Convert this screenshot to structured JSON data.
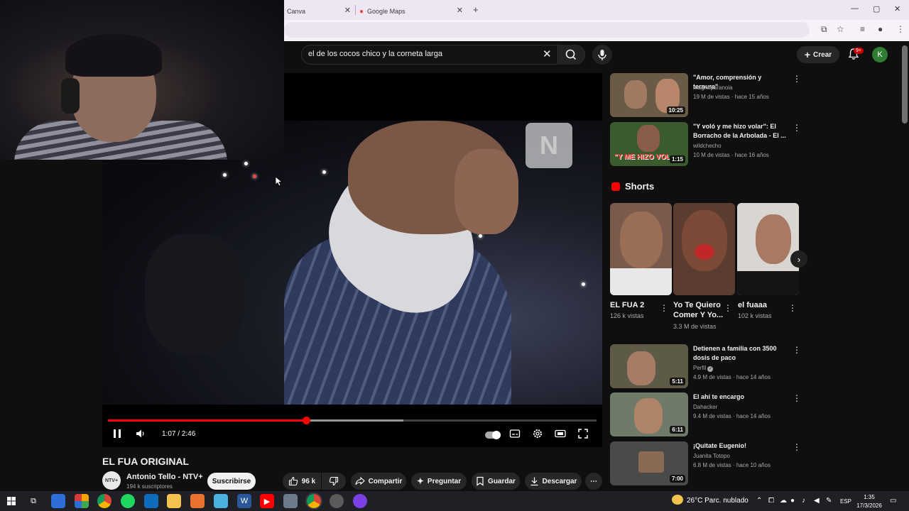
{
  "browser": {
    "tabs": [
      {
        "label": "Canva"
      },
      {
        "label": "Google Maps"
      }
    ],
    "new_tab": "+",
    "controls": {
      "minimize": "—",
      "maximize": "▢",
      "close": "✕"
    }
  },
  "youtube": {
    "search_query": "el de los cocos chico y la corneta larga",
    "create_label": "Crear",
    "notifications_badge": "9+",
    "avatar_letter": "K"
  },
  "player": {
    "time": "1:07 / 2:46",
    "progress_played": 0.405,
    "progress_buffered": 0.605,
    "watermark": "N"
  },
  "video": {
    "title": "EL FUA ORIGINAL",
    "channel_avatar_text": "NTV+",
    "channel": "Antonio Tello - NTV+",
    "subscribers": "194 k suscriptores",
    "subscribe_label": "Suscribirse",
    "likes": "96 k",
    "share_label": "Compartir",
    "ask_label": "Preguntar",
    "save_label": "Guardar",
    "download_label": "Descargar"
  },
  "sidebar": {
    "top_videos": [
      {
        "title": "\"Amor, comprensión y ternura\"",
        "channel": "magnoparanoia",
        "meta": "19 M de vistas · hace 15 años",
        "duration": "10:25",
        "thumb_bg": "#6a5a48"
      },
      {
        "title": "\"Y voló y me hizo volar\": El Borracho de la Arbolada - El ...",
        "channel": "wildchecho",
        "meta": "10 M de vistas · hace 16 años",
        "duration": "1:15",
        "thumb_bg": "#3b5a2e",
        "overlay": "\"Y ME HIZO VOL"
      }
    ],
    "shorts_heading": "Shorts",
    "shorts": [
      {
        "title": "EL FUA 2",
        "views": "126 k vistas",
        "thumb_bg": "#7a5a4c"
      },
      {
        "title": "Yo Te Quiero Comer Y Yo...",
        "views": "3.3 M de vistas",
        "thumb_bg": "#5a3d30"
      },
      {
        "title": "el fuaaa",
        "views": "102 k vistas",
        "thumb_bg": "#d9d5d0"
      }
    ],
    "videos": [
      {
        "title": "Detienen a familia con 3500 dosis de paco",
        "channel": "Perfil",
        "meta": "4.9 M de vistas · hace 14 años",
        "duration": "5:11",
        "thumb_bg": "#5e5a48",
        "verified": true
      },
      {
        "title": "El ahí te encargo",
        "channel": "Dahacker",
        "meta": "9.4 M de vistas · hace 14 años",
        "duration": "6:11",
        "thumb_bg": "#6f7a68"
      },
      {
        "title": "¡Quitate Eugenio!",
        "channel": "Juanita Totopo",
        "meta": "6.8 M de vistas · hace 10 años",
        "duration": "7:00",
        "thumb_bg": "#4a4a48"
      }
    ]
  },
  "taskbar": {
    "weather": "26°C  Parc. nublado",
    "language": "ESP",
    "time": "1:35",
    "date": "17/3/2026"
  },
  "icons": {
    "search": "search-icon",
    "mic": "mic-icon",
    "bell": "bell-icon",
    "play_pause": "pause-icon"
  },
  "colors": {
    "accent": "#ff0000",
    "background": "#0f0f0f",
    "surface": "#272727"
  }
}
